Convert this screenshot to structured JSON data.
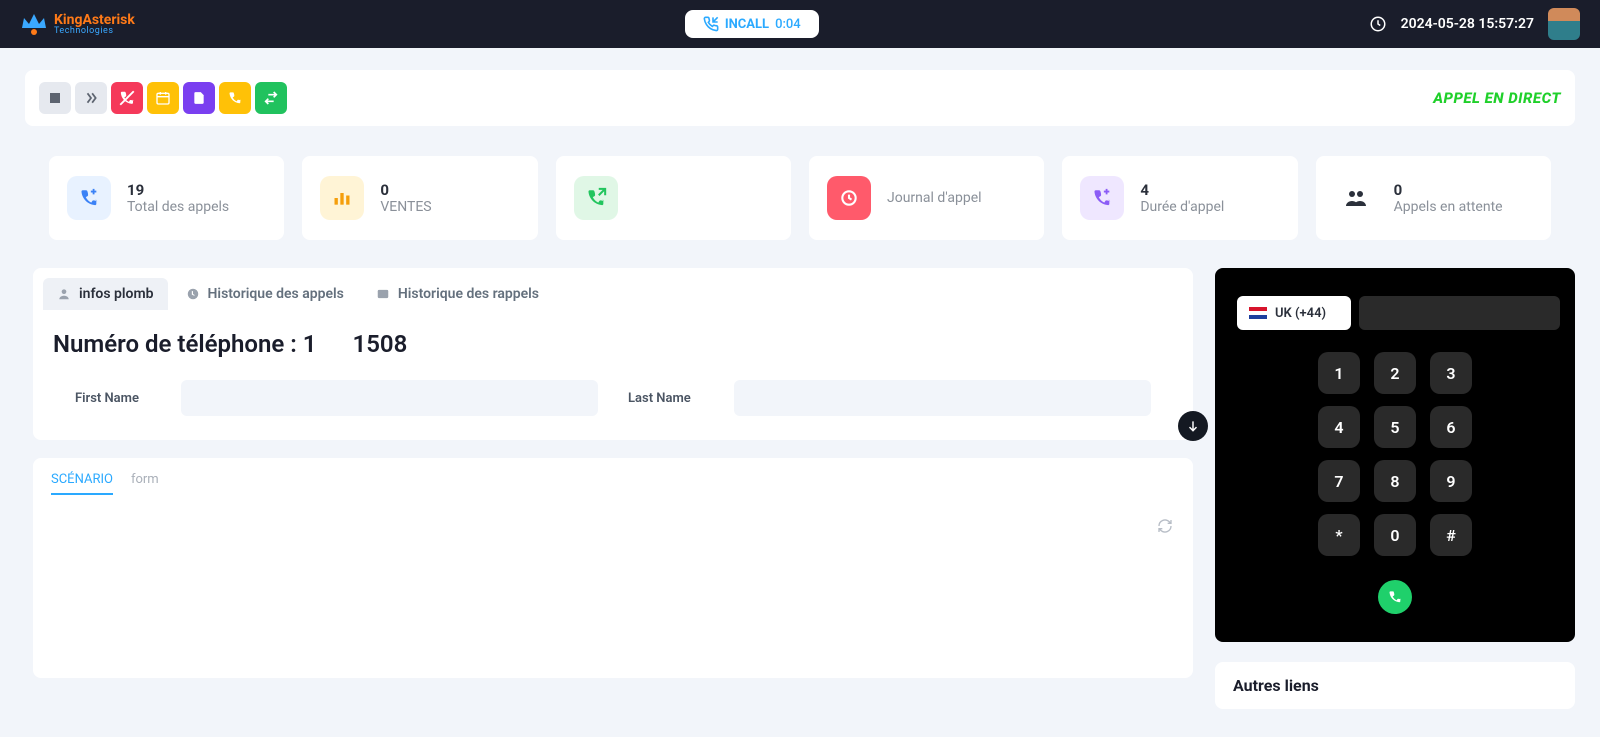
{
  "header": {
    "brand_primary": "KingAsterisk",
    "brand_secondary": "Technologies",
    "incall_label": "INCALL",
    "incall_timer": "0:04",
    "datetime": "2024-05-28 15:57:27"
  },
  "toolbar": {
    "live_call_label": "APPEL EN DIRECT"
  },
  "stats": {
    "total_calls": {
      "value": "19",
      "label": "Total des appels"
    },
    "sales": {
      "value": "0",
      "label": "VENTES"
    },
    "calls_received": {
      "value": "",
      "label": ""
    },
    "call_log": {
      "value": "",
      "label": "Journal d'appel"
    },
    "call_duration": {
      "value": "4",
      "label": "Durée d'appel"
    },
    "waiting_calls": {
      "value": "0",
      "label": "Appels en attente"
    }
  },
  "tabs": {
    "lead_info": "infos plomb",
    "call_history": "Historique des appels",
    "callback_history": "Historique des rappels"
  },
  "lead": {
    "phone_label": "Numéro de téléphone : ",
    "phone_prefix": "1",
    "phone_rest": "1508",
    "first_name_label": "First Name",
    "first_name_value": "",
    "last_name_label": "Last Name",
    "last_name_value": ""
  },
  "scenario": {
    "tab_scenario": "SCÉNARIO",
    "tab_form": "form"
  },
  "dialer": {
    "country_code_label": "UK (+44)",
    "input_value": "",
    "keys": [
      "1",
      "2",
      "3",
      "4",
      "5",
      "6",
      "7",
      "8",
      "9",
      "*",
      "0",
      "#"
    ]
  },
  "other_links": {
    "title": "Autres liens"
  }
}
